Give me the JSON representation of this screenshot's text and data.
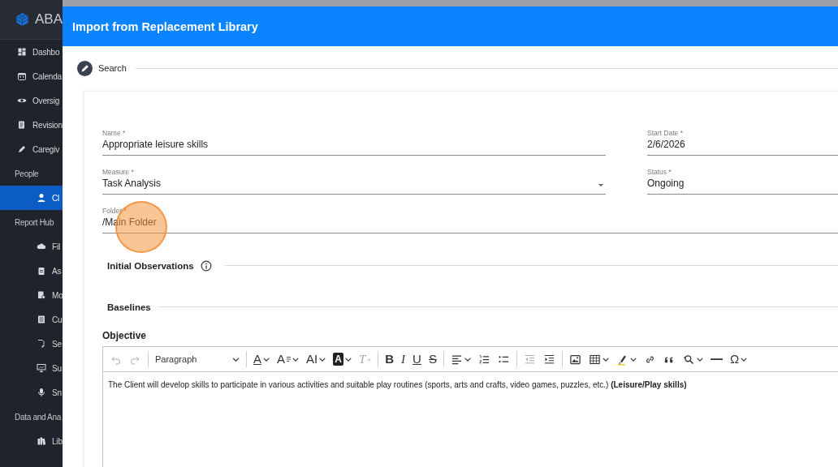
{
  "sidebar": {
    "brand": "ABA",
    "items": [
      {
        "kind": "link",
        "label": "Dashbo",
        "selected": false
      },
      {
        "kind": "link",
        "label": "Calenda",
        "selected": false
      },
      {
        "kind": "link",
        "label": "Oversig",
        "selected": false
      },
      {
        "kind": "link",
        "label": "Revision",
        "selected": false
      },
      {
        "kind": "link",
        "label": "Caregiv",
        "selected": false
      },
      {
        "kind": "section",
        "label": "People"
      },
      {
        "kind": "sublink",
        "label": "Cl",
        "selected": true
      },
      {
        "kind": "section",
        "label": "Report Hub"
      },
      {
        "kind": "sublink",
        "label": "Fil",
        "selected": false
      },
      {
        "kind": "sublink",
        "label": "As",
        "selected": false
      },
      {
        "kind": "sublink",
        "label": "Mo",
        "selected": false
      },
      {
        "kind": "sublink",
        "label": "Cu",
        "selected": false
      },
      {
        "kind": "sublink",
        "label": "Se",
        "selected": false
      },
      {
        "kind": "sublink",
        "label": "Su",
        "selected": false
      },
      {
        "kind": "sublink",
        "label": "Sn",
        "selected": false
      },
      {
        "kind": "section",
        "label": "Data and Ana"
      },
      {
        "kind": "sublink",
        "label": "Lib",
        "selected": false
      }
    ]
  },
  "dialog": {
    "title": "Import from Replacement Library",
    "step": {
      "label": "Search"
    },
    "form": {
      "rows": [
        [
          {
            "kind": "text",
            "label": "Name *",
            "value": "Appropriate leisure skills"
          },
          {
            "kind": "text",
            "label": "Start Date *",
            "value": "2/6/2026"
          }
        ],
        [
          {
            "kind": "select",
            "label": "Measure *",
            "value": "Task Analysis"
          },
          {
            "kind": "text",
            "label": "Status *",
            "value": "Ongoing"
          }
        ],
        [
          {
            "kind": "text",
            "label": "Folder *",
            "value": "/Main Folder"
          }
        ]
      ]
    },
    "sections": [
      {
        "title": "Initial Observations",
        "info": true
      },
      {
        "title": "Baselines",
        "info": false
      }
    ],
    "objective": {
      "label": "Objective",
      "toolbar": [
        [
          {
            "kind": "icon",
            "disabled": true,
            "dropdown": false
          },
          {
            "kind": "icon",
            "disabled": true,
            "dropdown": false
          }
        ],
        [
          {
            "kind": "select",
            "text": "Paragraph",
            "disabled": false,
            "dropdown": true
          }
        ],
        [
          {
            "kind": "glyph",
            "text": "A",
            "disabled": false,
            "dropdown": true
          },
          {
            "kind": "glyph",
            "text": "A",
            "disabled": false,
            "dropdown": true
          },
          {
            "kind": "glyph",
            "text": "AI",
            "disabled": false,
            "dropdown": true
          },
          {
            "kind": "glyph",
            "text": "A",
            "disabled": false,
            "dropdown": true
          },
          {
            "kind": "glyph",
            "text": "T",
            "disabled": true,
            "dropdown": false
          }
        ],
        [
          {
            "kind": "glyph",
            "text": "B",
            "disabled": false,
            "dropdown": false
          },
          {
            "kind": "glyph",
            "text": "I",
            "disabled": false,
            "dropdown": false
          },
          {
            "kind": "glyph",
            "text": "U",
            "disabled": false,
            "dropdown": false
          },
          {
            "kind": "glyph",
            "text": "S",
            "disabled": false,
            "dropdown": false
          }
        ],
        [
          {
            "kind": "icon",
            "disabled": false,
            "dropdown": true
          },
          {
            "kind": "icon",
            "disabled": false,
            "dropdown": false
          },
          {
            "kind": "icon",
            "disabled": false,
            "dropdown": false
          }
        ],
        [
          {
            "kind": "icon",
            "disabled": true,
            "dropdown": false
          },
          {
            "kind": "icon",
            "disabled": false,
            "dropdown": false
          }
        ],
        [
          {
            "kind": "icon",
            "disabled": false,
            "dropdown": false
          },
          {
            "kind": "icon",
            "disabled": false,
            "dropdown": true
          },
          {
            "kind": "icon",
            "disabled": false,
            "dropdown": true
          },
          {
            "kind": "icon",
            "disabled": false,
            "dropdown": false
          },
          {
            "kind": "icon",
            "disabled": false,
            "dropdown": false
          },
          {
            "kind": "icon",
            "disabled": false,
            "dropdown": true
          },
          {
            "kind": "icon",
            "disabled": false,
            "dropdown": false
          },
          {
            "kind": "glyph",
            "text": "Ω",
            "disabled": false,
            "dropdown": true
          }
        ]
      ],
      "content": "The Client will develop skills to participate in various activities and suitable play routines (sports, arts and crafts, video games, puzzles, etc.) **(Leisure/Play skills)**"
    }
  }
}
